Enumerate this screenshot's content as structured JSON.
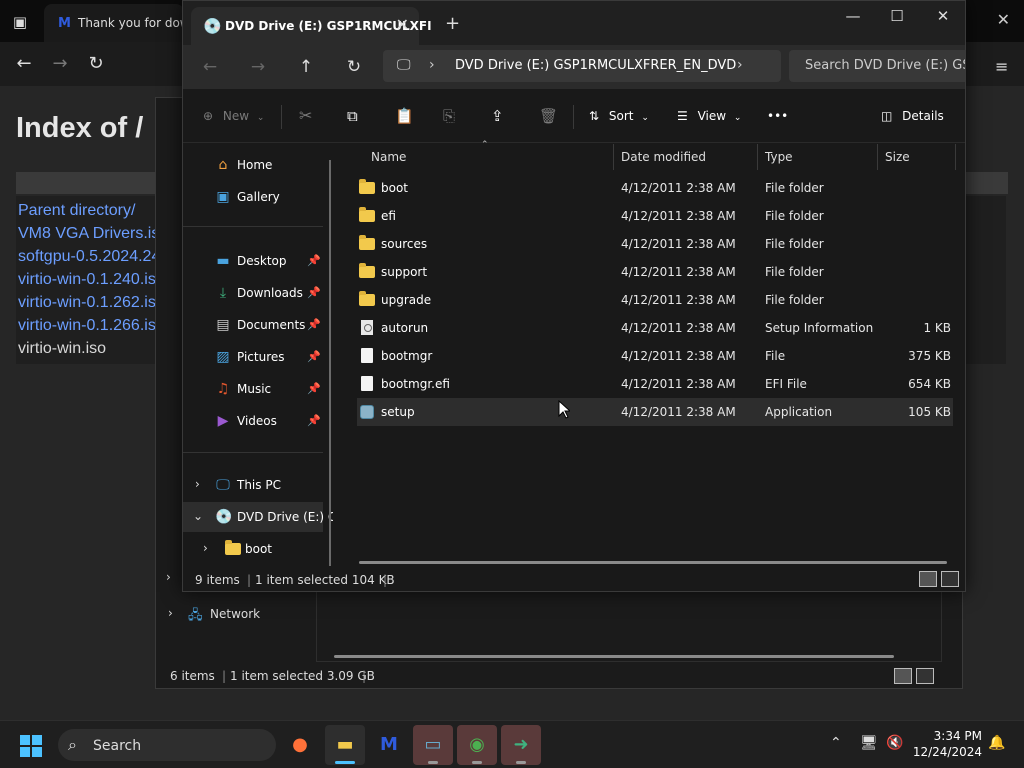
{
  "browser": {
    "tab_title": "Thank you for down",
    "page_heading": "Index of /",
    "listing": [
      {
        "text": "Parent directory/",
        "link": true
      },
      {
        "text": "VM8 VGA Drivers.is",
        "link": true
      },
      {
        "text": "softgpu-0.5.2024.24",
        "link": true
      },
      {
        "text": "virtio-win-0.1.240.is",
        "link": true
      },
      {
        "text": "virtio-win-0.1.262.is",
        "link": true
      },
      {
        "text": "virtio-win-0.1.266.is",
        "link": true
      },
      {
        "text": "virtio-win.iso",
        "link": false
      }
    ]
  },
  "back_explorer": {
    "network_label": "Network",
    "status_items": "6 items",
    "status_selected": "1 item selected  3.09 GB"
  },
  "explorer": {
    "tab_title": "DVD Drive (E:) GSP1RMCULXFI",
    "address": "DVD Drive (E:) GSP1RMCULXFRER_EN_DVD",
    "search_placeholder": "Search DVD Drive (E:) GSP",
    "toolbar": {
      "new_label": "New",
      "sort_label": "Sort",
      "view_label": "View",
      "more_label": "•••",
      "details_label": "Details"
    },
    "nav": {
      "home": "Home",
      "gallery": "Gallery",
      "desktop": "Desktop",
      "downloads": "Downloads",
      "documents": "Documents",
      "pictures": "Pictures",
      "music": "Music",
      "videos": "Videos",
      "this_pc": "This PC",
      "dvd_drive": "DVD Drive (E:) G",
      "boot": "boot"
    },
    "columns": {
      "name": "Name",
      "date": "Date modified",
      "type": "Type",
      "size": "Size"
    },
    "files": [
      {
        "name": "boot",
        "date": "4/12/2011 2:38 AM",
        "type": "File folder",
        "size": "",
        "icon": "folder-icon"
      },
      {
        "name": "efi",
        "date": "4/12/2011 2:38 AM",
        "type": "File folder",
        "size": "",
        "icon": "folder-icon"
      },
      {
        "name": "sources",
        "date": "4/12/2011 2:38 AM",
        "type": "File folder",
        "size": "",
        "icon": "folder-icon"
      },
      {
        "name": "support",
        "date": "4/12/2011 2:38 AM",
        "type": "File folder",
        "size": "",
        "icon": "folder-icon"
      },
      {
        "name": "upgrade",
        "date": "4/12/2011 2:38 AM",
        "type": "File folder",
        "size": "",
        "icon": "folder-icon"
      },
      {
        "name": "autorun",
        "date": "4/12/2011 2:38 AM",
        "type": "Setup Information",
        "size": "1 KB",
        "icon": "setup-info-icon"
      },
      {
        "name": "bootmgr",
        "date": "4/12/2011 2:38 AM",
        "type": "File",
        "size": "375 KB",
        "icon": "file-icon"
      },
      {
        "name": "bootmgr.efi",
        "date": "4/12/2011 2:38 AM",
        "type": "EFI File",
        "size": "654 KB",
        "icon": "file-icon"
      },
      {
        "name": "setup",
        "date": "4/12/2011 2:38 AM",
        "type": "Application",
        "size": "105 KB",
        "icon": "application-icon"
      }
    ],
    "status_items": "9 items",
    "status_selected": "1 item selected  104 KB"
  },
  "taskbar": {
    "search_label": "Search",
    "time": "3:34 PM",
    "date": "12/24/2024"
  },
  "colors": {
    "accent": "#4cc2ff",
    "folder": "#f2c94c",
    "link": "#6c9eff"
  }
}
